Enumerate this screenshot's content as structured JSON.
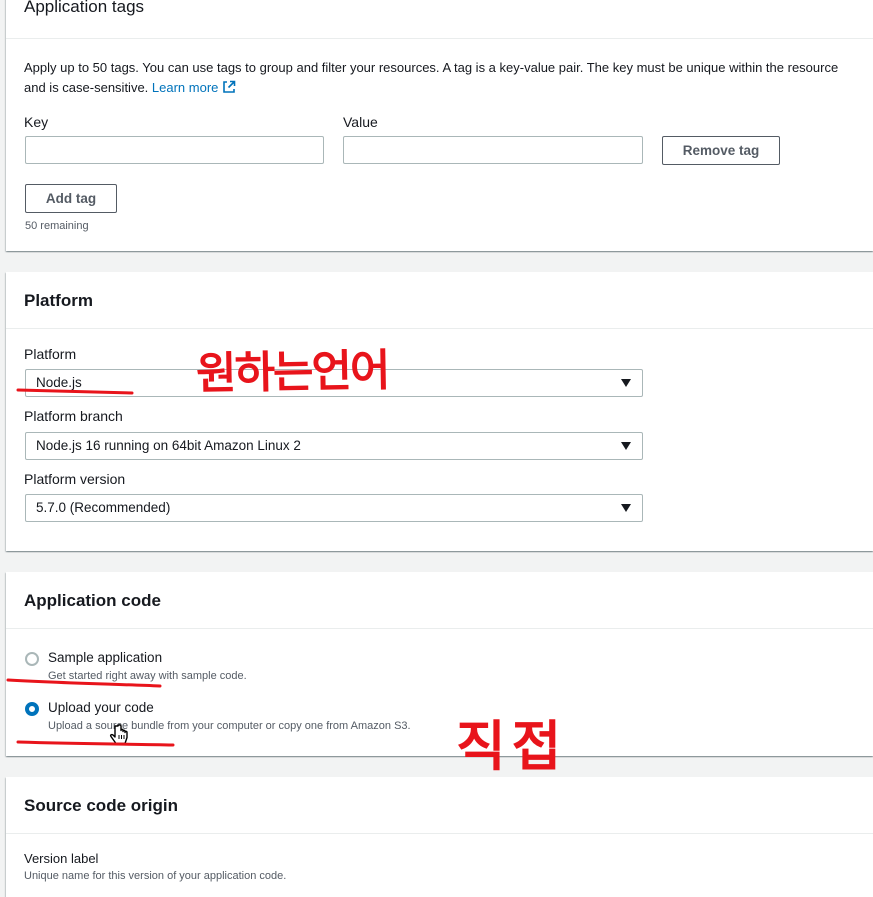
{
  "tags": {
    "title": "Application tags",
    "description": "Apply up to 50 tags. You can use tags to group and filter your resources. A tag is a key-value pair. The key must be unique within the resource and is case-sensitive.",
    "learn_more": "Learn more",
    "key_label": "Key",
    "value_label": "Value",
    "key_value": "",
    "value_value": "",
    "remove_label": "Remove tag",
    "add_label": "Add tag",
    "remaining": "50 remaining"
  },
  "platform": {
    "title": "Platform",
    "platform_label": "Platform",
    "platform_value": "Node.js",
    "branch_label": "Platform branch",
    "branch_value": "Node.js 16 running on 64bit Amazon Linux 2",
    "version_label": "Platform version",
    "version_value": "5.7.0 (Recommended)"
  },
  "app_code": {
    "title": "Application code",
    "options": [
      {
        "label": "Sample application",
        "description": "Get started right away with sample code.",
        "selected": false
      },
      {
        "label": "Upload your code",
        "description": "Upload a source bundle from your computer or copy one from Amazon S3.",
        "selected": true
      }
    ]
  },
  "source": {
    "title": "Source code origin",
    "version_label": "Version label",
    "version_desc": "Unique name for this version of your application code."
  },
  "annotations": {
    "note_language": "원하는언어",
    "note_direct": "직접",
    "ink_color": "#e8141b"
  }
}
